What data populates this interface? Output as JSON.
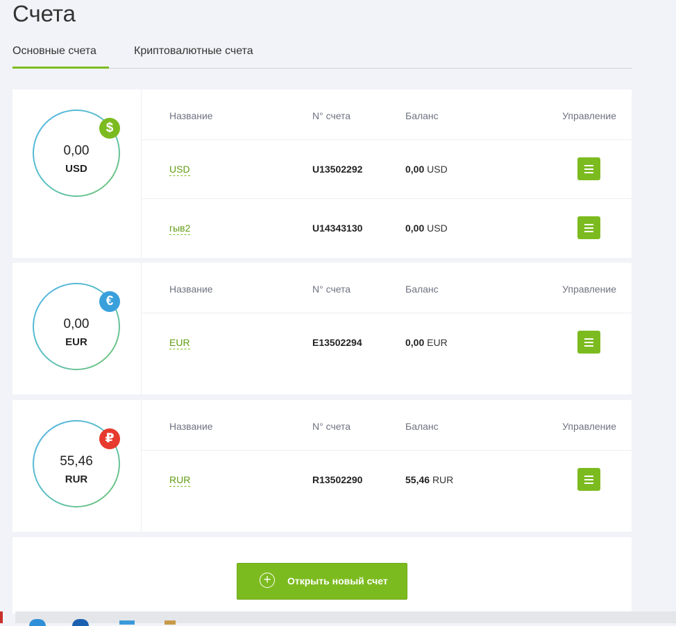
{
  "page": {
    "title": "Счета"
  },
  "tabs": [
    {
      "label": "Основные счета",
      "active": true
    },
    {
      "label": "Криптовалютные счета",
      "active": false
    }
  ],
  "columns": {
    "name": "Название",
    "number": "N° счета",
    "balance": "Баланс",
    "management": "Управление"
  },
  "groups": [
    {
      "total": "0,00",
      "currency": "USD",
      "badge_symbol": "$",
      "badge_color": "#7cbb1f",
      "accounts": [
        {
          "name": "USD",
          "number": "U13502292",
          "balance_value": "0,00",
          "balance_currency": "USD"
        },
        {
          "name": "гыв2",
          "number": "U14343130",
          "balance_value": "0,00",
          "balance_currency": "USD"
        }
      ]
    },
    {
      "total": "0,00",
      "currency": "EUR",
      "badge_symbol": "€",
      "badge_color": "#3aa0dc",
      "accounts": [
        {
          "name": "EUR",
          "number": "E13502294",
          "balance_value": "0,00",
          "balance_currency": "EUR"
        }
      ]
    },
    {
      "total": "55,46",
      "currency": "RUR",
      "badge_symbol": "₽",
      "badge_color": "#e63b2e",
      "accounts": [
        {
          "name": "RUR",
          "number": "R13502290",
          "balance_value": "55,46",
          "balance_currency": "RUR"
        }
      ]
    }
  ],
  "actions": {
    "open_new_account": "Открыть новый счет"
  },
  "colors": {
    "accent": "#7cbb1f",
    "background": "#f2f3f8"
  }
}
